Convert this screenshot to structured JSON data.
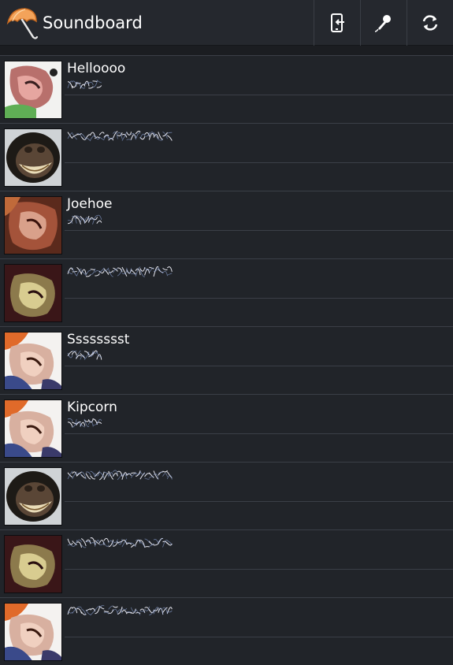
{
  "app": {
    "title": "Soundboard",
    "icon": "umbrella-icon",
    "accent": "#f0a050"
  },
  "toolbar": {
    "actions": [
      {
        "icon": "phone-import-icon",
        "label": "Import"
      },
      {
        "icon": "microphone-icon",
        "label": "Record"
      },
      {
        "icon": "refresh-icon",
        "label": "Refresh"
      }
    ]
  },
  "sounds": [
    {
      "name": "Helloooo",
      "thumb": "pink-green"
    },
    {
      "name": "",
      "thumb": "chimp"
    },
    {
      "name": "Joehoe",
      "thumb": "brown"
    },
    {
      "name": "",
      "thumb": "yellow"
    },
    {
      "name": "Sssssssst",
      "thumb": "orange-blue"
    },
    {
      "name": "Kipcorn",
      "thumb": "orange-blue"
    },
    {
      "name": "",
      "thumb": "chimp"
    },
    {
      "name": "",
      "thumb": "yellow"
    },
    {
      "name": "",
      "thumb": "orange-blue"
    }
  ]
}
